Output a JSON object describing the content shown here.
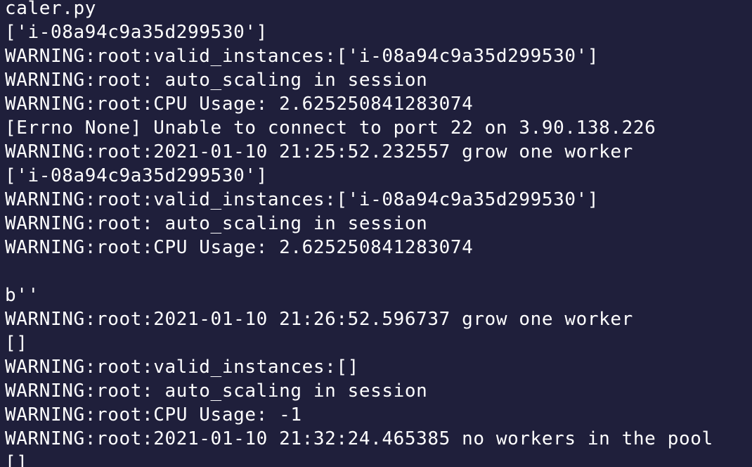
{
  "terminal": {
    "lines": [
      "caler.py",
      "['i-08a94c9a35d299530']",
      "WARNING:root:valid_instances:['i-08a94c9a35d299530']",
      "WARNING:root: auto_scaling in session",
      "WARNING:root:CPU Usage: 2.625250841283074",
      "[Errno None] Unable to connect to port 22 on 3.90.138.226",
      "WARNING:root:2021-01-10 21:25:52.232557 grow one worker",
      "['i-08a94c9a35d299530']",
      "WARNING:root:valid_instances:['i-08a94c9a35d299530']",
      "WARNING:root: auto_scaling in session",
      "WARNING:root:CPU Usage: 2.625250841283074",
      "",
      "b''",
      "WARNING:root:2021-01-10 21:26:52.596737 grow one worker",
      "[]",
      "WARNING:root:valid_instances:[]",
      "WARNING:root: auto_scaling in session",
      "WARNING:root:CPU Usage: -1",
      "WARNING:root:2021-01-10 21:32:24.465385 no workers in the pool",
      "[]"
    ]
  },
  "colors": {
    "background": "#1f1f3b",
    "text": "#ffffff"
  }
}
